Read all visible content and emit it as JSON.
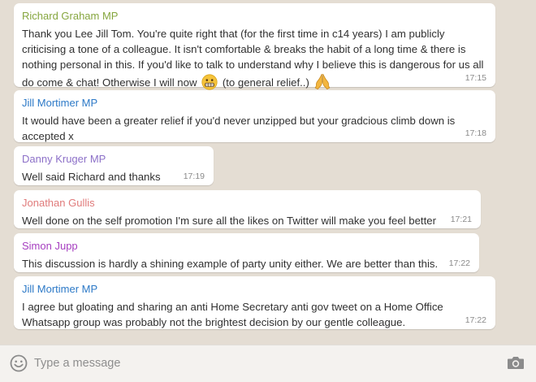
{
  "messages": [
    {
      "sender": "Richard Graham MP",
      "sender_color": "#86a63f",
      "text_before_emoji": "Thank you Lee Jill Tom. You're quite right that (for the first time in c14 years) I am publicly criticising a tone of a colleague. It isn't comfortable & breaks the habit of a long time & there is nothing personal in this. If you'd like to talk to understand why I believe this is dangerous for us all do come & chat! Otherwise I will now",
      "emoji_1": "grimacing-face-emoji",
      "text_middle": "(to general relief..)",
      "emoji_2": "folded-hands-emoji",
      "time": "17:15"
    },
    {
      "sender": "Jill Mortimer MP",
      "sender_color": "#2c79c7",
      "text": "It would have been a greater relief if you'd never unzipped but your gradcious climb down is accepted x",
      "time": "17:18"
    },
    {
      "sender": "Danny Kruger MP",
      "sender_color": "#8c70c8",
      "text": "Well said Richard and thanks",
      "time": "17:19"
    },
    {
      "sender": "Jonathan Gullis",
      "sender_color": "#e07b7b",
      "text": "Well done on the self promotion I'm sure all the likes on Twitter will make you feel better",
      "time": "17:21"
    },
    {
      "sender": "Simon Jupp",
      "sender_color": "#a63fc0",
      "text": "This discussion is hardly a shining example of party unity either. We are better than this.",
      "time": "17:22"
    },
    {
      "sender": "Jill Mortimer MP",
      "sender_color": "#2c79c7",
      "text": "I agree but gloating and sharing an anti Home Secretary anti gov tweet on a Home Office Whatsapp group was probably not the brightest decision by our gentle colleague.",
      "time": "17:22"
    }
  ],
  "composer": {
    "placeholder": "Type a message",
    "emoji_icon": "smiley-icon",
    "camera_icon": "camera-icon"
  }
}
